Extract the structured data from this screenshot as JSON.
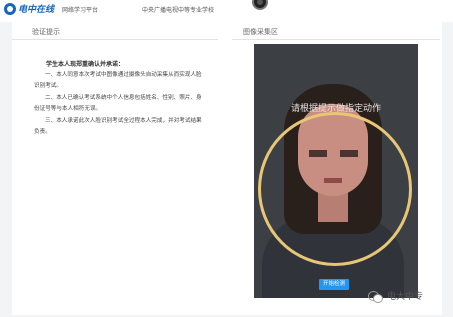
{
  "header": {
    "logo_text": "电中在线",
    "nav_items": [
      "网络学习平台",
      "中央广播电视中等专业学校"
    ],
    "camera_icon": "webcam-icon"
  },
  "verification": {
    "title": "验证提示",
    "notice_heading": "学生本人现郑重确认并承诺：",
    "paragraphs": [
      "一、本人同意本次考试中图像通过摄像头自动采集从而实现人脸识别考试。",
      "二、本人已确认考试系统中个人信息包括姓名、性别、照片、身份证号等与本人相符无误。",
      "三、本人承诺此次人脸识别考试全过程本人完成，并对考试结果负责。"
    ]
  },
  "capture": {
    "title": "图像采集区",
    "prompt": "请根据提示做指定动作",
    "start_button": "开始检测",
    "ring_color": "#e7c677",
    "accent": "#2196f3"
  },
  "watermark": {
    "icon": "wechat-icon",
    "text": "电大中专"
  }
}
